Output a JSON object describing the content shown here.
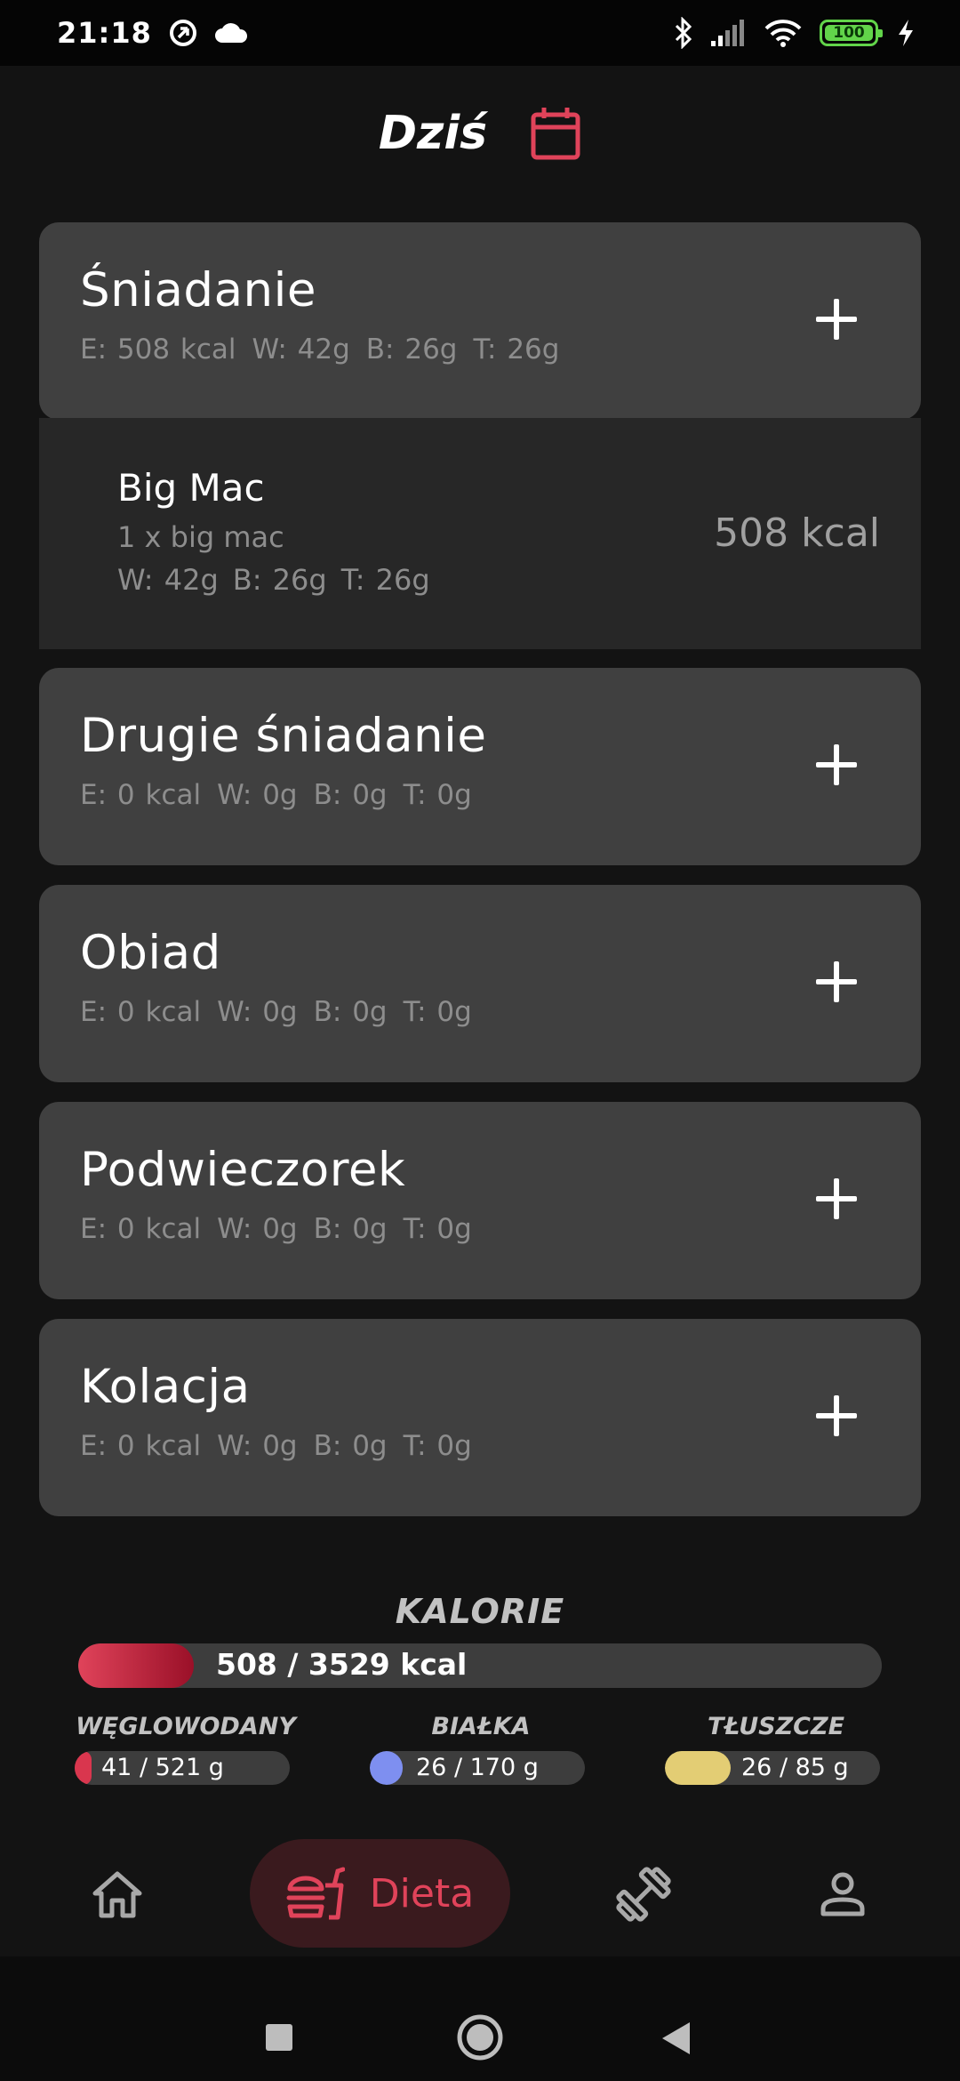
{
  "status": {
    "time": "21:18",
    "battery": "100",
    "icons": [
      "vpn-icon",
      "cloud-icon",
      "bluetooth-icon",
      "signal-icon",
      "wifi-icon",
      "battery-icon",
      "charging-icon"
    ]
  },
  "header": {
    "title": "Dziś",
    "calendar_icon": "calendar-icon"
  },
  "meals": [
    {
      "name": "Śniadanie",
      "energy": "E: 508 kcal",
      "carbs": "W: 42g",
      "protein": "B: 26g",
      "fat": "T: 26g"
    },
    {
      "name": "Drugie śniadanie",
      "energy": "E: 0 kcal",
      "carbs": "W: 0g",
      "protein": "B: 0g",
      "fat": "T: 0g"
    },
    {
      "name": "Obiad",
      "energy": "E: 0 kcal",
      "carbs": "W: 0g",
      "protein": "B: 0g",
      "fat": "T: 0g"
    },
    {
      "name": "Podwieczorek",
      "energy": "E: 0 kcal",
      "carbs": "W: 0g",
      "protein": "B: 0g",
      "fat": "T: 0g"
    },
    {
      "name": "Kolacja",
      "energy": "E: 0 kcal",
      "carbs": "W: 0g",
      "protein": "B: 0g",
      "fat": "T: 0g"
    }
  ],
  "food_item": {
    "name": "Big Mac",
    "quantity": "1 x big mac",
    "carbs": "W: 42g",
    "protein": "B: 26g",
    "fat": "T: 26g",
    "kcal": "508 kcal"
  },
  "summary": {
    "title": "KALORIE",
    "kcal_text": "508 / 3529 kcal",
    "kcal_progress": 0.144,
    "carbs_label": "WĘGLOWODANY",
    "carbs_text": "41 / 521 g",
    "carbs_progress": 0.079,
    "protein_label": "BIAŁKA",
    "protein_text": "26 / 170 g",
    "protein_progress": 0.153,
    "fat_label": "TŁUSZCZE",
    "fat_text": "26 / 85 g",
    "fat_progress": 0.306,
    "colors": {
      "kcal": "#e0435a",
      "carbs": "#d9364e",
      "protein": "#7e8ff0",
      "fat": "#e3cd74"
    }
  },
  "nav": {
    "active_label": "Dieta",
    "items": [
      "home-icon",
      "diet-icon",
      "dumbbell-icon",
      "profile-icon"
    ]
  },
  "colors": {
    "accent": "#e0435a",
    "card": "#404040",
    "background": "#131313"
  }
}
